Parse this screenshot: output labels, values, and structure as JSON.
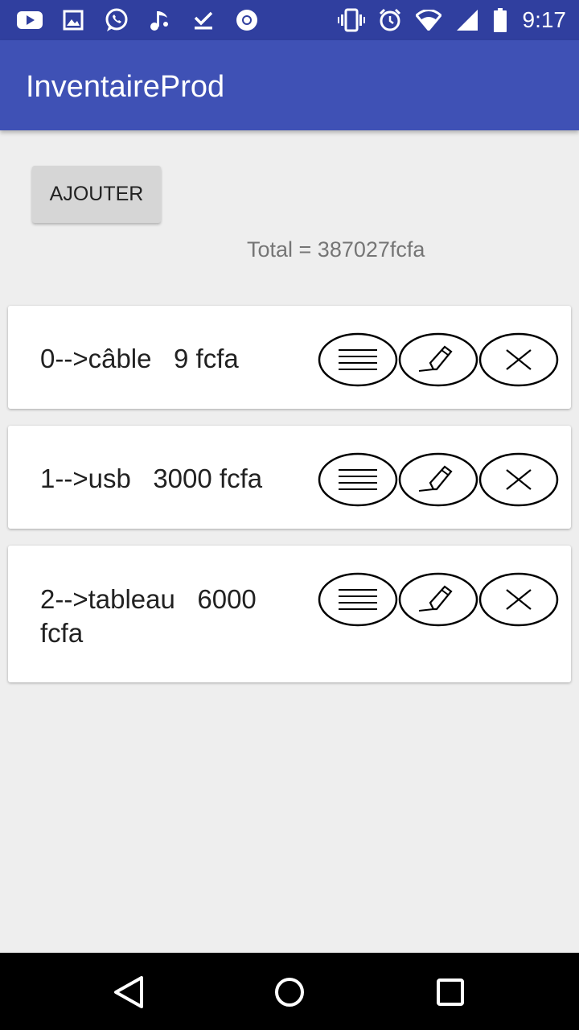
{
  "status_bar": {
    "time": "9:17",
    "left_icons": [
      "youtube-icon",
      "image-icon",
      "whatsapp-icon",
      "music-icon",
      "download-done-icon",
      "chrome-icon"
    ],
    "right_icons": [
      "vibrate-icon",
      "alarm-icon",
      "wifi-icon",
      "signal-icon",
      "battery-icon"
    ]
  },
  "app_bar": {
    "title": "InventaireProd"
  },
  "add_button": {
    "label": "AJOUTER"
  },
  "total": {
    "text": "Total = 387027fcfa"
  },
  "items": [
    {
      "text": "0-->câble   9 fcfa"
    },
    {
      "text": "1-->usb   3000 fcfa"
    },
    {
      "text": "2-->tableau   6000 fcfa"
    }
  ],
  "item_actions": [
    "menu-icon",
    "edit-pencil-icon",
    "delete-x-icon"
  ],
  "colors": {
    "status_bar": "#303f9f",
    "app_bar": "#3f51b5",
    "background": "#eeeeee"
  },
  "nav_bar": {
    "buttons": [
      "back-icon",
      "home-icon",
      "recents-icon"
    ]
  }
}
